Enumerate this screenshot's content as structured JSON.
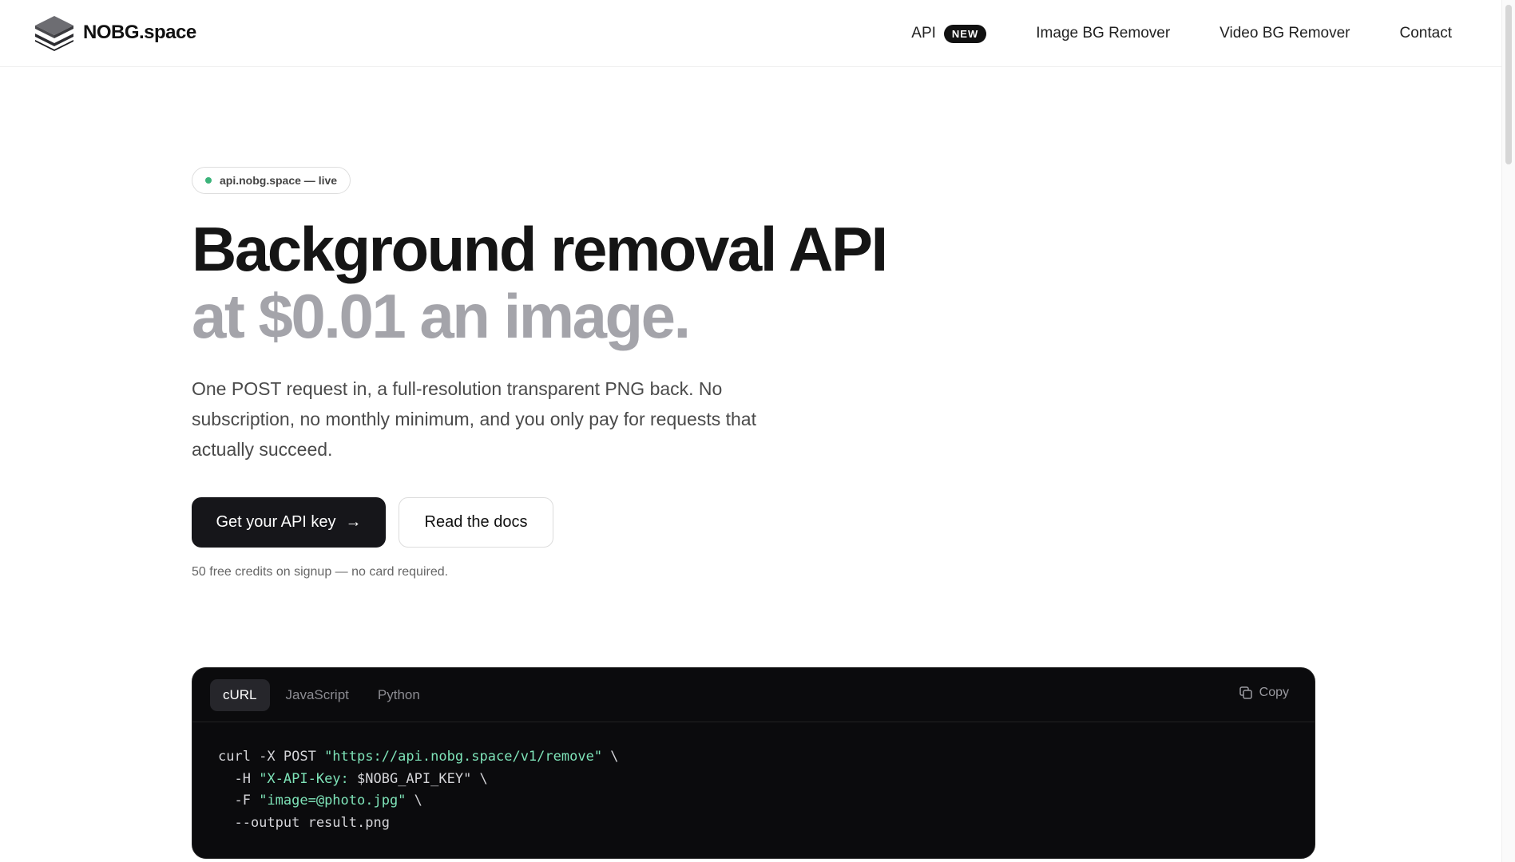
{
  "brand": {
    "name": "NOBG.space",
    "icon": "layers-logo-icon"
  },
  "nav": {
    "items": [
      {
        "label": "API",
        "badge": "NEW"
      },
      {
        "label": "Image BG Remover"
      },
      {
        "label": "Video BG Remover"
      },
      {
        "label": "Contact"
      }
    ]
  },
  "hero": {
    "status": "api.nobg.space — live",
    "headline_line1": "Background removal API",
    "headline_line2": "at $0.01 an image.",
    "description": "One POST request in, a full-resolution transparent PNG back. No subscription, no monthly minimum, and you only pay for requests that actually succeed.",
    "primary_cta": "Get your API key",
    "secondary_cta": "Read the docs",
    "note": "50 free credits on signup — no card required."
  },
  "code": {
    "tabs": [
      "cURL",
      "JavaScript",
      "Python"
    ],
    "active_tab": "cURL",
    "copy_label": "Copy",
    "lines": [
      {
        "plain1": "curl -X POST ",
        "str": "\"https://api.nobg.space/v1/remove\"",
        "plain2": " \\"
      },
      {
        "plain1": "  -H ",
        "str": "\"X-API-Key: ",
        "plain2": "$NOBG_API_KEY\" \\"
      },
      {
        "plain1": "  -F ",
        "str": "\"image=@photo.jpg\"",
        "plain2": " \\"
      },
      {
        "plain1": "  --output result.png",
        "str": "",
        "plain2": ""
      }
    ]
  },
  "colors": {
    "accent_dark": "#16161a",
    "status_green": "#3bb37a",
    "headline_muted": "#a4a4aa",
    "code_string": "#7ee3b8"
  }
}
